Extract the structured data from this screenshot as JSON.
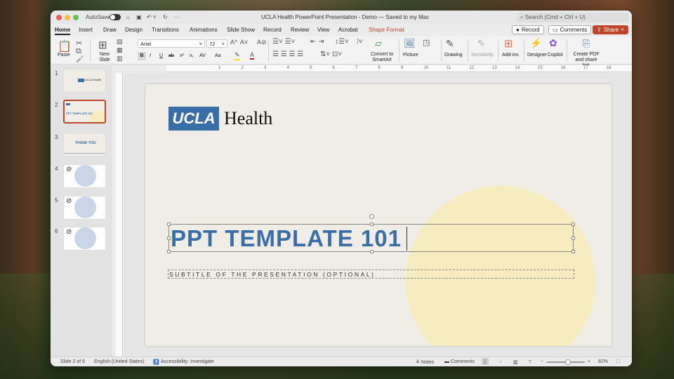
{
  "window": {
    "title": "UCLA Health PowerPoint Presentation - Demo — Saved to my Mac",
    "autosave": "AutoSave",
    "search_placeholder": "Search (Cmd + Ctrl + U)"
  },
  "tabs": [
    {
      "label": "Home"
    },
    {
      "label": "Insert"
    },
    {
      "label": "Draw"
    },
    {
      "label": "Design"
    },
    {
      "label": "Transitions"
    },
    {
      "label": "Animations"
    },
    {
      "label": "Slide Show"
    },
    {
      "label": "Record"
    },
    {
      "label": "Review"
    },
    {
      "label": "View"
    },
    {
      "label": "Acrobat"
    },
    {
      "label": "Shape Format"
    }
  ],
  "active_tab": "Home",
  "actions": {
    "record": "Record",
    "comments": "Comments",
    "share": "Share"
  },
  "ribbon": {
    "paste": "Paste",
    "new_slide": "New Slide",
    "font": "Arial",
    "size": "72",
    "convert": "Convert to SmartArt",
    "picture": "Picture",
    "drawing": "Drawing",
    "sensitivity": "Sensitivity",
    "addins": "Add-ins",
    "designer": "Designer",
    "copilot": "Copilot",
    "create_pdf": "Create PDF and share link",
    "bold": "B",
    "italic": "I",
    "underline": "U",
    "strike": "ab",
    "sup": "x²",
    "sub": "x₂",
    "spacing": "AV",
    "case": "Aa"
  },
  "ruler": [
    "1",
    "2",
    "3",
    "4",
    "5",
    "6",
    "7",
    "8",
    "9",
    "10",
    "11",
    "12",
    "13",
    "14",
    "15",
    "16",
    "17",
    "18"
  ],
  "slides": [
    {
      "num": "1",
      "text": "UCLA Health"
    },
    {
      "num": "2",
      "text": "PPT TEMPLATE 101"
    },
    {
      "num": "3",
      "text": "THANK YOU"
    },
    {
      "num": "4",
      "text": ""
    },
    {
      "num": "5",
      "text": ""
    },
    {
      "num": "6",
      "text": ""
    }
  ],
  "slide": {
    "logo_box": "UCLA",
    "logo_text": "Health",
    "title": "PPT TEMPLATE 101",
    "subtitle": "SUBTITLE OF THE PRESENTATION (OPTIONAL)"
  },
  "status": {
    "slide": "Slide 2 of 6",
    "language": "English (United States)",
    "accessibility": "Accessibility: Investigate",
    "notes": "Notes",
    "comments": "Comments",
    "zoom": "82%",
    "zoom_level": 82
  },
  "colors": {
    "brand_blue": "#3a6ea8",
    "accent": "#c0462b",
    "circle": "#f6ecc0"
  }
}
